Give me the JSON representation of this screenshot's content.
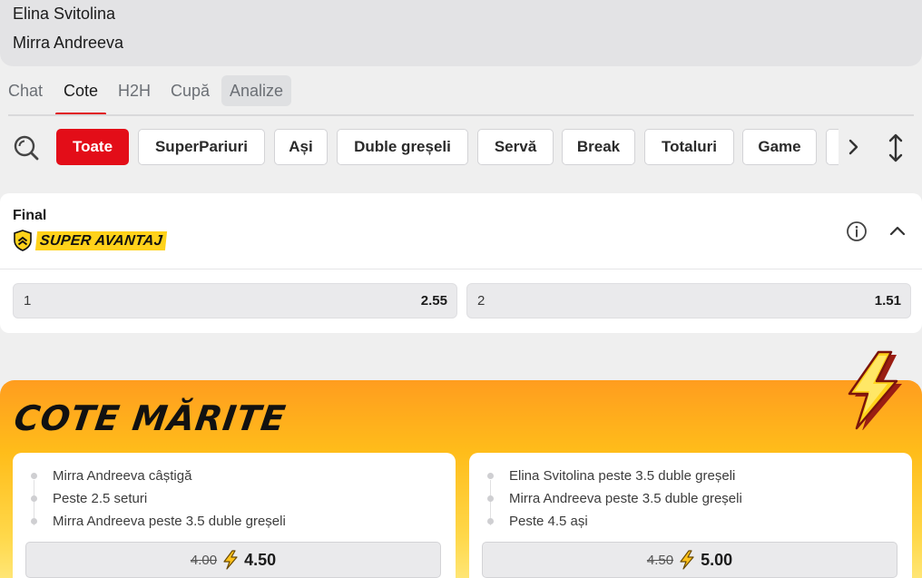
{
  "match": {
    "player1": "Elina Svitolina",
    "player2": "Mirra Andreeva"
  },
  "tabs": [
    {
      "label": "Chat"
    },
    {
      "label": "Cote",
      "active": true
    },
    {
      "label": "H2H"
    },
    {
      "label": "Cupă"
    },
    {
      "label": "Analize"
    }
  ],
  "filters": {
    "chips": [
      "Toate",
      "SuperPariuri",
      "Ași",
      "Duble greșeli",
      "Servă",
      "Break",
      "Totaluri",
      "Game"
    ],
    "active": "Toate"
  },
  "market": {
    "title": "Final",
    "badge": "SUPER AVANTAJ",
    "outcomes": [
      {
        "label": "1",
        "odd": "2.55"
      },
      {
        "label": "2",
        "odd": "1.51"
      }
    ]
  },
  "boost": {
    "title": "COTE MĂRITE",
    "cards": [
      {
        "legs": [
          "Mirra Andreeva câștigă",
          "Peste 2.5 seturi",
          "Mirra Andreeva peste 3.5 duble greșeli"
        ],
        "old_odd": "4.00",
        "new_odd": "4.50"
      },
      {
        "legs": [
          "Elina Svitolina peste 3.5 duble greșeli",
          "Mirra Andreeva peste 3.5 duble greșeli",
          "Peste 4.5 ași"
        ],
        "old_odd": "4.50",
        "new_odd": "5.00"
      }
    ]
  },
  "colors": {
    "accent_red": "#e30d18",
    "badge_yellow": "#ffd21a",
    "boost_orange": "#ff9d1f"
  },
  "icons": [
    "search-icon",
    "chevron-right-icon",
    "sort-arrows-icon",
    "shield-chevron-icon",
    "info-icon",
    "chevron-up-icon",
    "lightning-bolt-icon"
  ]
}
